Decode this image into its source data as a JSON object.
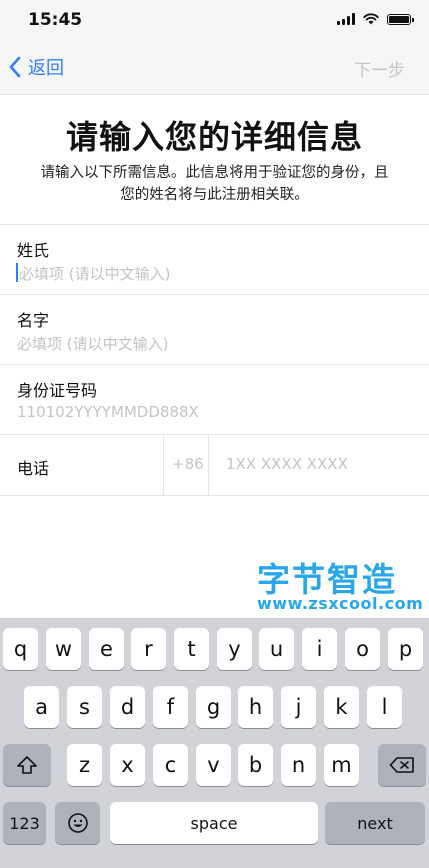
{
  "status_bar": {
    "time": "15:45",
    "icons": [
      "signal-icon",
      "wifi-icon",
      "battery-icon"
    ]
  },
  "nav": {
    "back_label": "返回",
    "next_label": "下一步"
  },
  "header": {
    "title": "请输入您的详细信息",
    "subtitle_line1": "请输入以下所需信息。此信息将用于验证您的身份，且",
    "subtitle_line2": "您的姓名将与此注册相关联。"
  },
  "form": {
    "surname": {
      "label": "姓氏",
      "placeholder": "必填项 (请以中文输入)"
    },
    "given_name": {
      "label": "名字",
      "placeholder": "必填项 (请以中文输入)"
    },
    "id_number": {
      "label": "身份证号码",
      "placeholder": "110102YYYYMMDD888X"
    },
    "phone": {
      "label": "电话",
      "country_code": "+86",
      "placeholder": "1XX XXXX XXXX"
    }
  },
  "watermark": {
    "logo_text": "字节智造",
    "url": "www.zsxcool.com"
  },
  "keyboard": {
    "row1": [
      "q",
      "w",
      "e",
      "r",
      "t",
      "y",
      "u",
      "i",
      "o",
      "p"
    ],
    "row2": [
      "a",
      "s",
      "d",
      "f",
      "g",
      "h",
      "j",
      "k",
      "l"
    ],
    "row3": [
      "z",
      "x",
      "c",
      "v",
      "b",
      "n",
      "m"
    ],
    "shift_icon": "shift-icon",
    "delete_icon": "delete-icon",
    "emoji_icon": "emoji-icon",
    "numbers_label": "123",
    "space_label": "space",
    "next_label": "next"
  },
  "colors": {
    "accent": "#2f7ff6",
    "watermark": "#2aa6ea",
    "keyboard_bg": "#d1d3d9"
  }
}
